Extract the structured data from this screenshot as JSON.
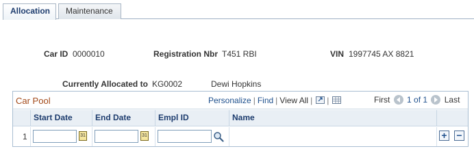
{
  "tabs": [
    {
      "label": "Allocation",
      "active": true
    },
    {
      "label": "Maintenance",
      "active": false
    }
  ],
  "fields": {
    "car_id_label": "Car ID",
    "car_id_value": "0000010",
    "registration_label": "Registration Nbr",
    "registration_value": "T451 RBI",
    "vin_label": "VIN",
    "vin_value": "1997745 AX 8821",
    "allocated_label": "Currently Allocated to",
    "allocated_id": "KG0002",
    "allocated_name": "Dewi Hopkins"
  },
  "grid": {
    "title": "Car Pool",
    "personalize": "Personalize",
    "find": "Find",
    "view_all": "View All",
    "first": "First",
    "page_info": "1 of 1",
    "last": "Last",
    "columns": [
      "Start Date",
      "End Date",
      "Empl ID",
      "Name"
    ],
    "rows": [
      {
        "num": "1",
        "start_date": "",
        "end_date": "",
        "empl_id": "",
        "name": ""
      }
    ],
    "add_label": "+",
    "delete_label": "−"
  },
  "icons": {
    "calendar": "calendar-icon",
    "lookup": "magnifier-icon",
    "zoom": "new-window-icon",
    "download": "spreadsheet-icon"
  },
  "colors": {
    "grid_title": "#a34a1a",
    "link": "#1d4f8c",
    "header_bg": "#e9eff5"
  }
}
